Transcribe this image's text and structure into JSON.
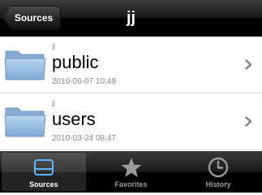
{
  "navbar": {
    "back_label": "Sources",
    "title": "jj"
  },
  "rows": [
    {
      "owner": "jj",
      "name": "public",
      "date": "2010-06-07 10:49",
      "icon": "folder-icon"
    },
    {
      "owner": "jj",
      "name": "users",
      "date": "2010-03-24 08:47",
      "icon": "folder-icon"
    }
  ],
  "tabs": [
    {
      "label": "Sources",
      "icon": "drive-icon",
      "active": true
    },
    {
      "label": "Favorites",
      "icon": "star-icon",
      "active": false
    },
    {
      "label": "History",
      "icon": "clock-icon",
      "active": false
    }
  ],
  "colors": {
    "navbar": "#000000",
    "folder": "#9ec2e6",
    "secondary_text": "#8a8a8a",
    "tab_active_icon": "#5fb4ff"
  }
}
